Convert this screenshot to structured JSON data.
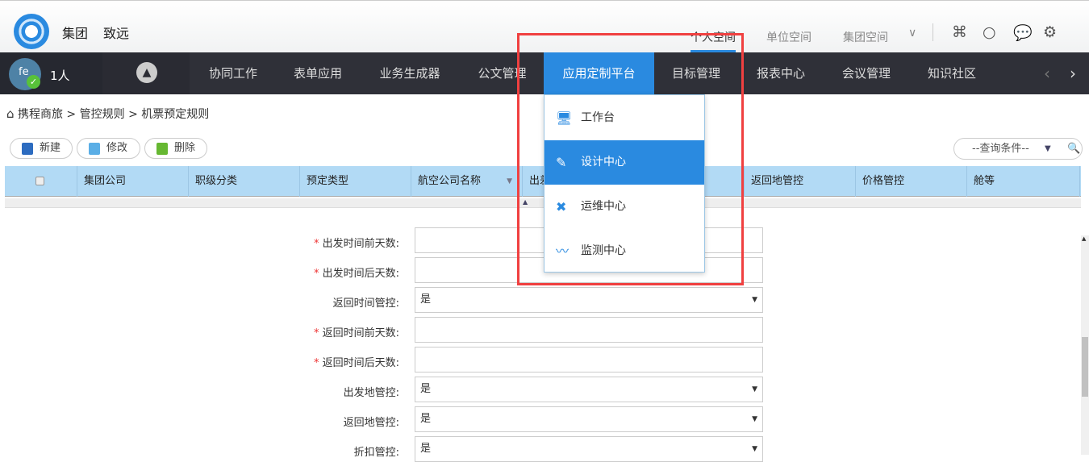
{
  "header": {
    "brand1": "集团",
    "brand2": "致远",
    "spaces": [
      "个人空间",
      "单位空间",
      "集团空间"
    ],
    "more": "∨"
  },
  "user": {
    "initials": "fe",
    "count": "1人"
  },
  "nav": {
    "items": [
      "协同工作",
      "表单应用",
      "业务生成器",
      "公文管理",
      "应用定制平台",
      "目标管理",
      "报表中心",
      "会议管理",
      "知识社区"
    ],
    "active": "应用定制平台"
  },
  "breadcrumb": "携程商旅 > 管控规则 > 机票预定规则",
  "toolbar": {
    "new": "新建",
    "edit": "修改",
    "delete": "删除",
    "query_placeholder": "--查询条件--"
  },
  "table": {
    "columns": [
      "集团公司",
      "职级分类",
      "预定类型",
      "航空公司名称",
      "出差",
      "返回地管控",
      "价格管控",
      "舱等"
    ]
  },
  "menu": {
    "items": [
      "工作台",
      "设计中心",
      "运维中心",
      "监测中心"
    ],
    "active": "设计中心"
  },
  "form": [
    {
      "label": "出发时间前天数:",
      "required": true,
      "value": ""
    },
    {
      "label": "出发时间后天数:",
      "required": true,
      "value": ""
    },
    {
      "label": "返回时间管控:",
      "required": false,
      "value": "是",
      "select": true
    },
    {
      "label": "返回时间前天数:",
      "required": true,
      "value": ""
    },
    {
      "label": "返回时间后天数:",
      "required": true,
      "value": ""
    },
    {
      "label": "出发地管控:",
      "required": false,
      "value": "是",
      "select": true
    },
    {
      "label": "返回地管控:",
      "required": false,
      "value": "是",
      "select": true
    },
    {
      "label": "折扣管控:",
      "required": false,
      "value": "是",
      "select": true
    }
  ],
  "colors": {
    "accent": "#2a8ae0",
    "nav_bg": "#2f3038",
    "header_row": "#b2daf5",
    "highlight": "#f04040"
  }
}
